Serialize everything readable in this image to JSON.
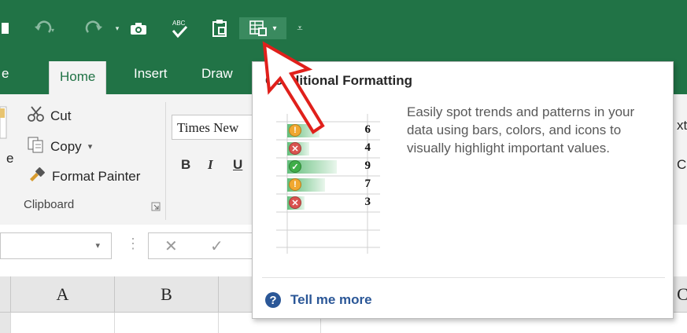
{
  "tabs": {
    "partial_file": "e",
    "items": [
      {
        "label": "Home",
        "active": true
      },
      {
        "label": "Insert",
        "active": false
      },
      {
        "label": "Draw",
        "active": false
      }
    ]
  },
  "ribbon": {
    "clipboard": {
      "cut_label": "Cut",
      "copy_label": "Copy",
      "format_painter_label": "Format Painter",
      "group_label": "Clipboard",
      "paste_partial": "e"
    },
    "font": {
      "font_name": "Times New",
      "bold": "B",
      "italic": "I",
      "underline": "U"
    },
    "right_partial": {
      "top": "xt",
      "bottom": "C"
    }
  },
  "formula_bar": {
    "cancel": "✕",
    "enter": "✓"
  },
  "grid": {
    "columns": [
      "A",
      "B",
      "C"
    ]
  },
  "tooltip": {
    "title": "Conditional Formatting",
    "description": "Easily spot trends and patterns in your data using bars, colors, and icons to visually highlight important values.",
    "help_link": "Tell me more",
    "help_icon": "?",
    "preview_rows": [
      {
        "value": "6",
        "status": "warning",
        "fill": 0.62
      },
      {
        "value": "4",
        "status": "error",
        "fill": 0.42
      },
      {
        "value": "9",
        "status": "ok",
        "fill": 0.95
      },
      {
        "value": "7",
        "status": "warning",
        "fill": 0.72
      },
      {
        "value": "3",
        "status": "error",
        "fill": 0.33
      }
    ]
  },
  "colors": {
    "excel_green": "#217346",
    "annotation_arrow": "#e0201b",
    "help_blue": "#2b5797"
  },
  "annotation": {
    "type": "arrow",
    "target": "conditional-formatting-button"
  }
}
